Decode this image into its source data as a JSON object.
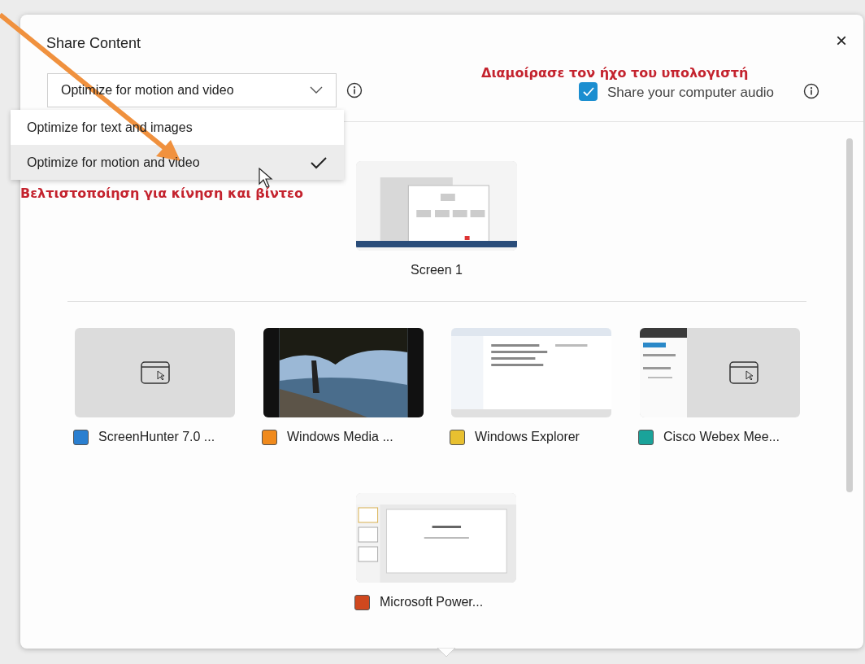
{
  "dialog": {
    "title": "Share Content",
    "close": "×"
  },
  "optimize": {
    "value": "Optimize for motion and video",
    "expanded": true,
    "options": [
      {
        "label": "Optimize for text and images",
        "selected": false
      },
      {
        "label": "Optimize for motion and video",
        "selected": true
      }
    ]
  },
  "annotations": [
    {
      "kind": "audio",
      "text": "Διαμοίρασε τον ήχο του υπολογιστή"
    },
    {
      "kind": "menu",
      "text": "Βελτιστοποίηση για κίνηση και βίντεο"
    }
  ],
  "audio": {
    "label": "Share your computer audio",
    "checked": true
  },
  "screens": [
    {
      "label": "Screen 1",
      "kind": "desktop"
    }
  ],
  "apps": [
    {
      "label": "ScreenHunter 7.0 ...",
      "kind": "placeholder",
      "color": "#2a7fd0"
    },
    {
      "label": "Windows Media ...",
      "color": "#f08a1c"
    },
    {
      "label": "Windows Explorer",
      "kind": "explorer",
      "color": "#e8c030"
    },
    {
      "label": "Cisco Webex Mee...",
      "kind": "partial",
      "color": "#1aa39a"
    },
    {
      "label": "Microsoft Power...",
      "kind": "slides",
      "color": "#d0481e"
    }
  ]
}
